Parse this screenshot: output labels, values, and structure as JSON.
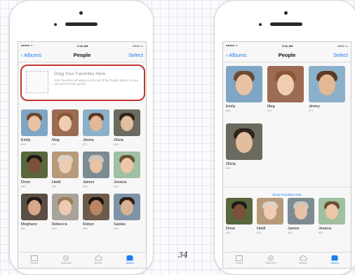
{
  "status": {
    "carrier": "●●●●● ᯤ",
    "time": "9:41 AM",
    "battery": "100% ▭"
  },
  "left_phone": {
    "nav": {
      "back": "Albums",
      "title": "People",
      "select": "Select"
    },
    "favorites_drop": {
      "title": "Drag Your Favorites Here",
      "description": "Your Favorites will appear at the top of the People album, so you can access them quickly."
    },
    "people": [
      {
        "name": "Emily",
        "count": "898"
      },
      {
        "name": "Meg",
        "count": "921"
      },
      {
        "name": "Jimmy",
        "count": "871"
      },
      {
        "name": "Olivia",
        "count": "850"
      },
      {
        "name": "Drew",
        "count": "880"
      },
      {
        "name": "Heidi",
        "count": "861"
      },
      {
        "name": "James",
        "count": "865"
      },
      {
        "name": "Jessica",
        "count": "852"
      },
      {
        "name": "Meghann",
        "count": "860"
      },
      {
        "name": "Rebecca",
        "count": "854"
      },
      {
        "name": "Robyn",
        "count": "856"
      },
      {
        "name": "Saskia",
        "count": "858"
      }
    ],
    "tabs": [
      "Photos",
      "Memories",
      "Shared",
      "Albums"
    ]
  },
  "right_phone": {
    "nav": {
      "back": "Albums",
      "title": "People",
      "select": "Select"
    },
    "favorites": [
      {
        "name": "Emily",
        "count": "898"
      },
      {
        "name": "Meg",
        "count": "921"
      },
      {
        "name": "Jimmy",
        "count": "871"
      },
      {
        "name": "Olivia",
        "count": "850"
      }
    ],
    "show_favorites_label": "Show Favorites Only",
    "people": [
      {
        "name": "Drew",
        "count": "880"
      },
      {
        "name": "Heidi",
        "count": "861"
      },
      {
        "name": "James",
        "count": "865"
      },
      {
        "name": "Jessica",
        "count": "852"
      }
    ],
    "tabs": [
      "Photos",
      "Memories",
      "Shared",
      "Albums"
    ]
  },
  "page_number": "34",
  "colors": {
    "accent": "#1e7cf2",
    "highlight": "#c2362e"
  }
}
